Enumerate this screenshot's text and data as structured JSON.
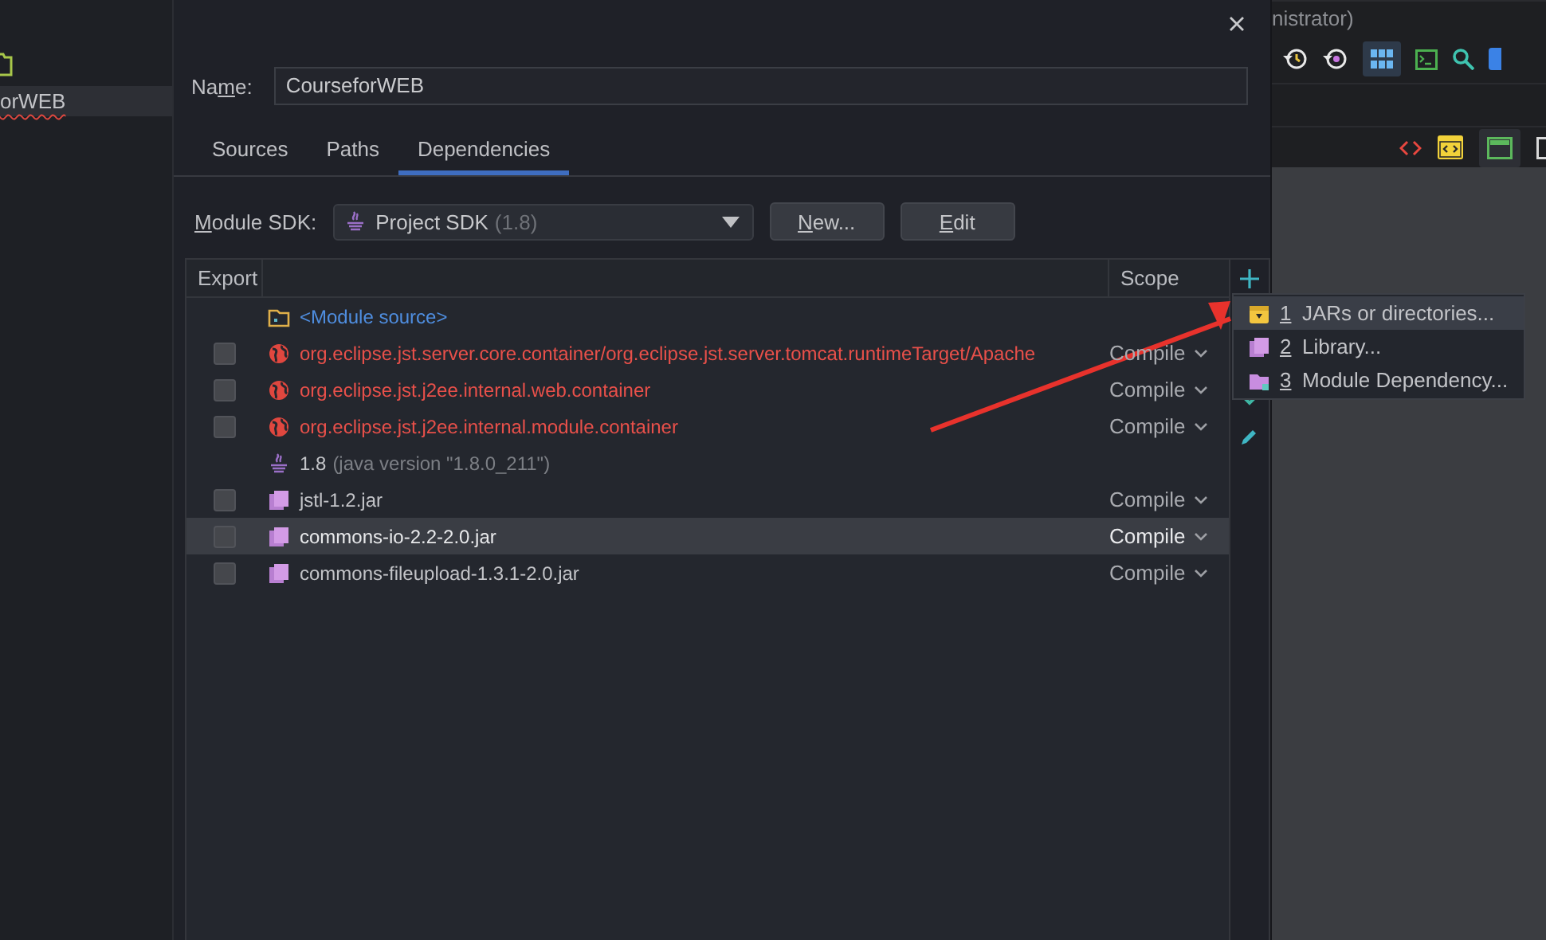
{
  "sidebar": {
    "items": [
      {
        "label": "orWEB",
        "selected": true,
        "misspelled": true
      }
    ]
  },
  "dialog": {
    "name_field": {
      "label": {
        "before": "Na",
        "key": "m",
        "after": "e:"
      },
      "value": "CourseforWEB"
    },
    "tabs": [
      {
        "label": "Sources",
        "selected": false
      },
      {
        "label": "Paths",
        "selected": false
      },
      {
        "label": "Dependencies",
        "selected": true
      }
    ],
    "module_sdk": {
      "label": {
        "key": "M",
        "after": "odule SDK:"
      },
      "value": "Project SDK",
      "version": "(1.8)",
      "buttons": [
        {
          "key": "N",
          "after": "ew..."
        },
        {
          "key": "E",
          "after": "dit"
        }
      ]
    },
    "table": {
      "columns": [
        "Export",
        "Scope"
      ],
      "rows": [
        {
          "kind": "module_source",
          "name": "<Module source>",
          "selected": false
        },
        {
          "kind": "error_library",
          "name": "org.eclipse.jst.server.core.container/org.eclipse.jst.server.tomcat.runtimeTarget/Apache",
          "checked": false,
          "scope": "Compile",
          "selected": false
        },
        {
          "kind": "error_library",
          "name": "org.eclipse.jst.j2ee.internal.web.container",
          "checked": false,
          "scope": "Compile",
          "selected": false
        },
        {
          "kind": "error_library",
          "name": "org.eclipse.jst.j2ee.internal.module.container",
          "checked": false,
          "scope": "Compile",
          "selected": false
        },
        {
          "kind": "sdk",
          "name": "1.8",
          "detail": "(java version \"1.8.0_211\")",
          "selected": false
        },
        {
          "kind": "jar",
          "name": "jstl-1.2.jar",
          "checked": false,
          "scope": "Compile",
          "selected": false
        },
        {
          "kind": "jar",
          "name": "commons-io-2.2-2.0.jar",
          "checked": false,
          "scope": "Compile",
          "selected": true
        },
        {
          "kind": "jar",
          "name": "commons-fileupload-1.3.1-2.0.jar",
          "checked": false,
          "scope": "Compile",
          "selected": false
        }
      ]
    },
    "add_menu": {
      "items": [
        {
          "number": "1",
          "label": "JARs or directories...",
          "kind": "jars",
          "selected": true
        },
        {
          "number": "2",
          "label": "Library...",
          "kind": "library",
          "selected": false
        },
        {
          "number": "3",
          "label": "Module Dependency...",
          "kind": "module",
          "selected": false
        }
      ]
    }
  },
  "background_window": {
    "title": "nistrator)"
  }
}
